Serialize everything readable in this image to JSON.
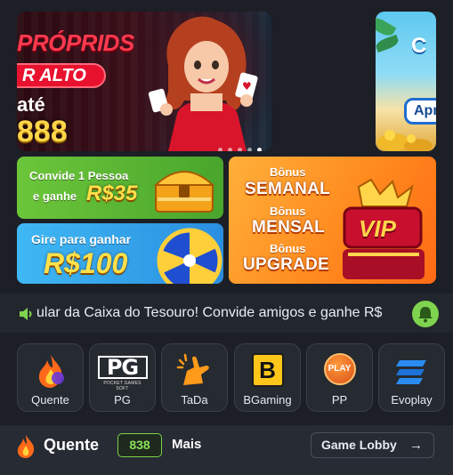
{
  "carousel": {
    "slide1": {
      "line1": "PRÓPRIDS",
      "pill": "R ALTO",
      "line3": "até",
      "number": "888"
    },
    "slide2": {
      "line1": "C",
      "button": "Apr"
    },
    "dots": 5,
    "active_dot": 4
  },
  "promos": {
    "invite": {
      "line1": "Convide 1 Pessoa",
      "line2": "e ganhe",
      "amount": "R$35"
    },
    "wheel": {
      "line1": "Gire para ganhar",
      "amount": "R$100"
    },
    "bonus": {
      "items": [
        {
          "small": "Bônus",
          "big": "SEMANAL"
        },
        {
          "small": "Bônus",
          "big": "MENSAL"
        },
        {
          "small": "Bônus",
          "big": "UPGRADE"
        }
      ],
      "badge": "VIP"
    }
  },
  "marquee": {
    "text": "ular da Caixa do Tesouro! Convide amigos e ganhe R$"
  },
  "providers": [
    {
      "label": "Quente",
      "icon": "flame-icon"
    },
    {
      "label": "PG",
      "icon": "pg-logo-icon",
      "sub": "POCKET GAMES SOFT"
    },
    {
      "label": "TaDa",
      "icon": "tada-hand-icon"
    },
    {
      "label": "BGaming",
      "icon": "bgaming-logo-icon",
      "letter": "B"
    },
    {
      "label": "PP",
      "icon": "pragmatic-play-icon",
      "letter": "PLAY"
    },
    {
      "label": "Evoplay",
      "icon": "evoplay-logo-icon"
    }
  ],
  "bottom": {
    "title": "Quente",
    "count": "838",
    "more": "Mais",
    "lobby": "Game Lobby",
    "arrow": "→"
  },
  "colors": {
    "accent_green": "#7bd34a",
    "background": "#1c1f25",
    "tile": "#262a31"
  }
}
